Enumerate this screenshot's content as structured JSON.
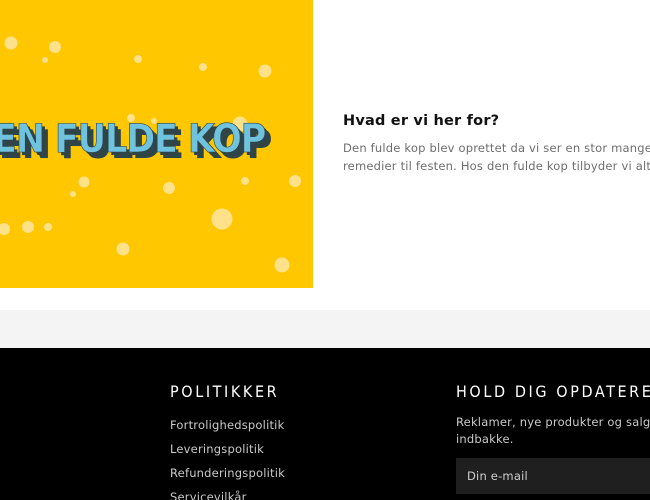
{
  "hero": {
    "logo_text": "DEN FULDE KOP",
    "background_color": "#ffc700"
  },
  "about": {
    "heading": "Hvad er vi her for?",
    "body_lines": [
      "Den fulde kop blev oprettet da vi ser en stor mangel på",
      "remedier til festen. Hos den fulde kop tilbyder vi alt til d"
    ]
  },
  "footer": {
    "policies": {
      "title": "POLITIKKER",
      "links": [
        "Fortrolighedspolitik",
        "Leveringspolitik",
        "Refunderingspolitik",
        "Servicevilkår"
      ]
    },
    "newsletter": {
      "title": "HOLD DIG OPDATERET",
      "text_lines": [
        "Reklamer, nye produkter og salg. Di",
        "indbakke."
      ],
      "email_placeholder": "Din e-mail"
    }
  }
}
